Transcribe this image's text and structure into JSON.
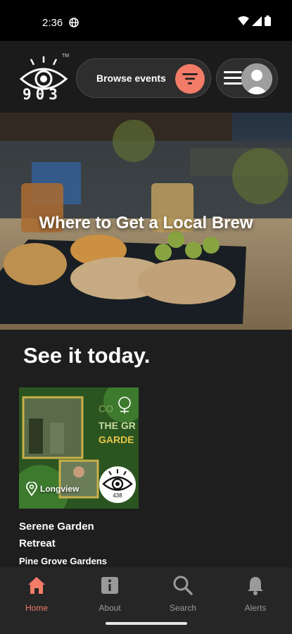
{
  "status": {
    "time": "2:36"
  },
  "brand": {
    "logo_text": "903",
    "tm": "TM"
  },
  "header": {
    "browse_label": "Browse events"
  },
  "hero": {
    "title": "Where to Get a Local Brew"
  },
  "section": {
    "title": "See it today."
  },
  "events": [
    {
      "title": "Serene Garden Retreat",
      "venue": "Pine Grove Gardens",
      "location": "Longview",
      "badge_count": "438",
      "image_text_1": "CO",
      "image_text_2": "THE GR",
      "image_text_3": "GARDE"
    }
  ],
  "nav": [
    {
      "label": "Home",
      "icon": "home-icon",
      "active": true
    },
    {
      "label": "About",
      "icon": "info-icon",
      "active": false
    },
    {
      "label": "Search",
      "icon": "search-icon",
      "active": false
    },
    {
      "label": "Alerts",
      "icon": "bell-icon",
      "active": false
    }
  ],
  "colors": {
    "accent": "#f27c68",
    "background": "#1e1e1e",
    "pill": "#2e2e2e"
  }
}
